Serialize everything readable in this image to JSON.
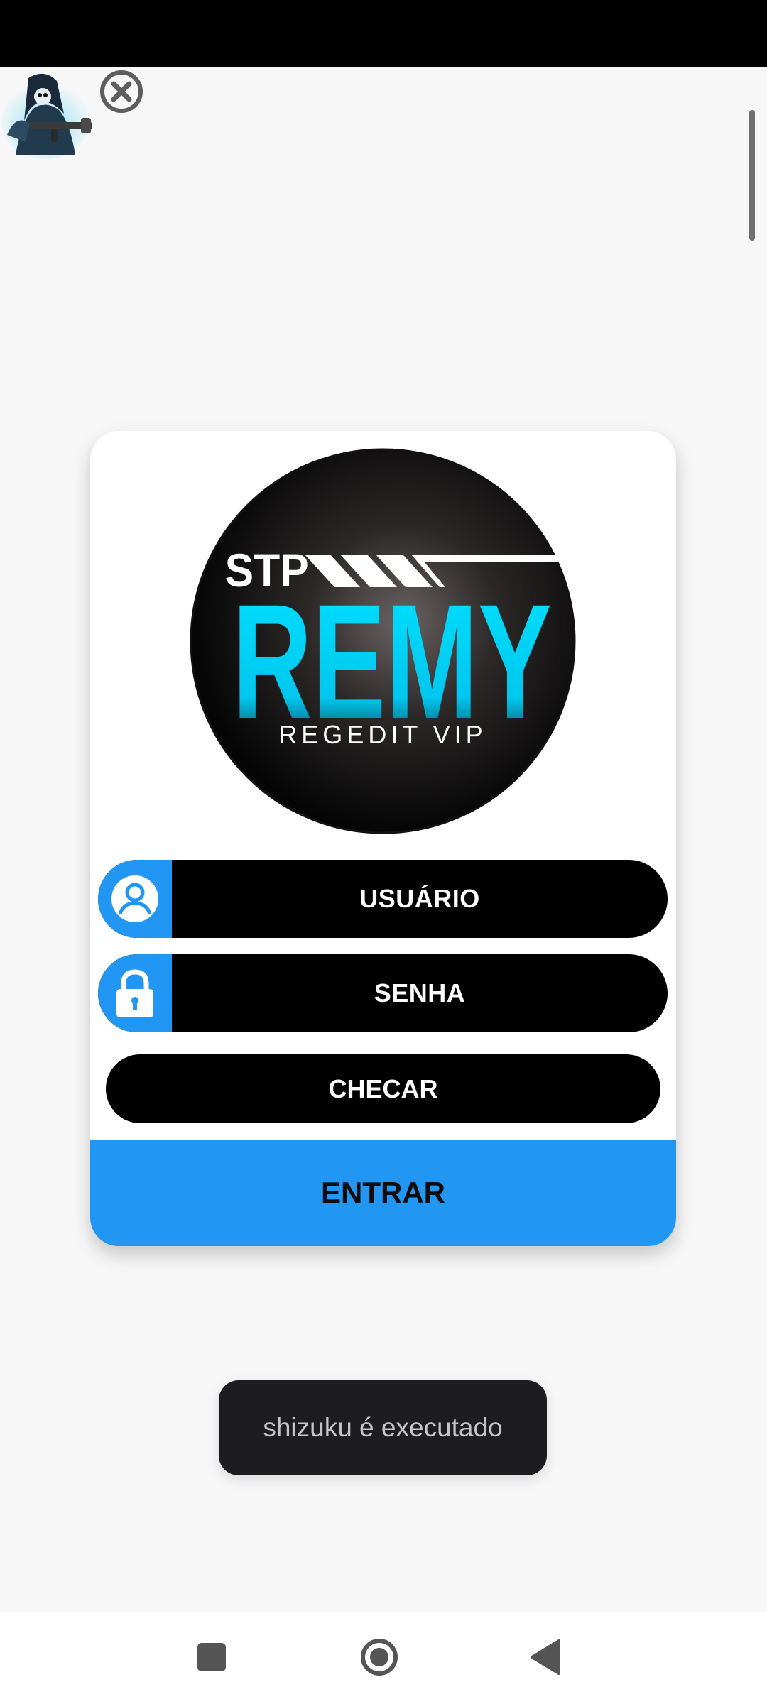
{
  "app": {
    "logo": {
      "brand_small": "STP",
      "brand_big": "REMY",
      "tagline": "REGEDIT VIP"
    },
    "floating_icon": "reaper-gunner-avatar",
    "close_icon": "close-circle-icon"
  },
  "login": {
    "username_label": "USUÁRIO",
    "username_icon": "user-icon",
    "password_label": "SENHA",
    "password_icon": "lock-icon",
    "check_button": "CHECAR",
    "enter_button": "ENTRAR"
  },
  "toast": {
    "message": "shizuku é executado"
  },
  "navigation": {
    "recents_icon": "square-icon",
    "home_icon": "circle-icon",
    "back_icon": "triangle-back-icon"
  },
  "colors": {
    "accent": "#2196f3",
    "field_bg": "#000000",
    "logo_cyan": "#00d7ff"
  }
}
